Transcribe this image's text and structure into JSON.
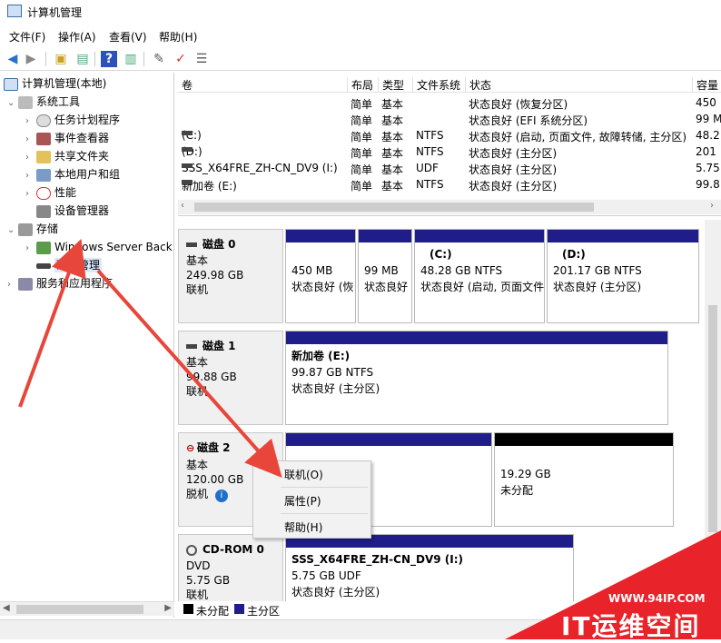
{
  "window": {
    "title": "计算机管理"
  },
  "menu": [
    "文件(F)",
    "操作(A)",
    "查看(V)",
    "帮助(H)"
  ],
  "tree": {
    "root": "计算机管理(本地)",
    "system_tools": "系统工具",
    "task_scheduler": "任务计划程序",
    "event_viewer": "事件查看器",
    "shared_folders": "共享文件夹",
    "local_users": "本地用户和组",
    "performance": "性能",
    "device_manager": "设备管理器",
    "storage": "存储",
    "windows_backup": "Windows Server Back",
    "disk_management": "磁盘管理",
    "services": "服务和应用程序"
  },
  "volumes": {
    "headers": [
      "卷",
      "布局",
      "类型",
      "文件系统",
      "状态",
      "容量"
    ],
    "rows": [
      [
        "",
        "简单",
        "基本",
        "",
        "状态良好 (恢复分区)",
        "450"
      ],
      [
        "",
        "简单",
        "基本",
        "",
        "状态良好 (EFI 系统分区)",
        "99 M"
      ],
      [
        "(C:)",
        "简单",
        "基本",
        "NTFS",
        "状态良好 (启动, 页面文件, 故障转储, 主分区)",
        "48.2"
      ],
      [
        "(D:)",
        "简单",
        "基本",
        "NTFS",
        "状态良好 (主分区)",
        "201"
      ],
      [
        "SSS_X64FRE_ZH-CN_DV9 (I:)",
        "简单",
        "基本",
        "UDF",
        "状态良好 (主分区)",
        "5.75"
      ],
      [
        "新加卷 (E:)",
        "简单",
        "基本",
        "NTFS",
        "状态良好 (主分区)",
        "99.8"
      ]
    ]
  },
  "disks": {
    "disk0": {
      "name": "磁盘 0",
      "type": "基本",
      "size": "249.98 GB",
      "state": "联机",
      "parts": [
        {
          "title": "",
          "size": "450 MB",
          "status": "状态良好 (恢"
        },
        {
          "title": "",
          "size": "99 MB",
          "status": "状态良好"
        },
        {
          "title": "(C:)",
          "size": "48.28 GB NTFS",
          "status": "状态良好 (启动, 页面文件"
        },
        {
          "title": "(D:)",
          "size": "201.17 GB NTFS",
          "status": "状态良好 (主分区)"
        }
      ]
    },
    "disk1": {
      "name": "磁盘 1",
      "type": "基本",
      "size": "99.88 GB",
      "state": "联机",
      "parts": [
        {
          "title": "新加卷 (E:)",
          "size": "99.87 GB NTFS",
          "status": "状态良好 (主分区)"
        }
      ]
    },
    "disk2": {
      "name": "磁盘 2",
      "type": "基本",
      "size": "120.00 GB",
      "state": "脱机",
      "parts": [
        {
          "title": "",
          "size": "",
          "status": ""
        },
        {
          "title": "",
          "size": "19.29 GB",
          "status": "未分配"
        }
      ]
    },
    "cdrom0": {
      "name": "CD-ROM 0",
      "type": "DVD",
      "size": "5.75 GB",
      "state": "联机",
      "parts": [
        {
          "title": "SSS_X64FRE_ZH-CN_DV9 (I:)",
          "size": "5.75 GB UDF",
          "status": "状态良好 (主分区)"
        }
      ]
    }
  },
  "legend": {
    "unallocated": "未分配",
    "primary": "主分区"
  },
  "context_menu": {
    "online": "联机(O)",
    "properties": "属性(P)",
    "help": "帮助(H)"
  },
  "watermark": {
    "url": "WWW.94IP.COM",
    "brand": "IT运维空间"
  },
  "colors": {
    "primary_partition": "#1f1d8a",
    "unallocated": "#000000",
    "annotation": "#e8463a"
  }
}
